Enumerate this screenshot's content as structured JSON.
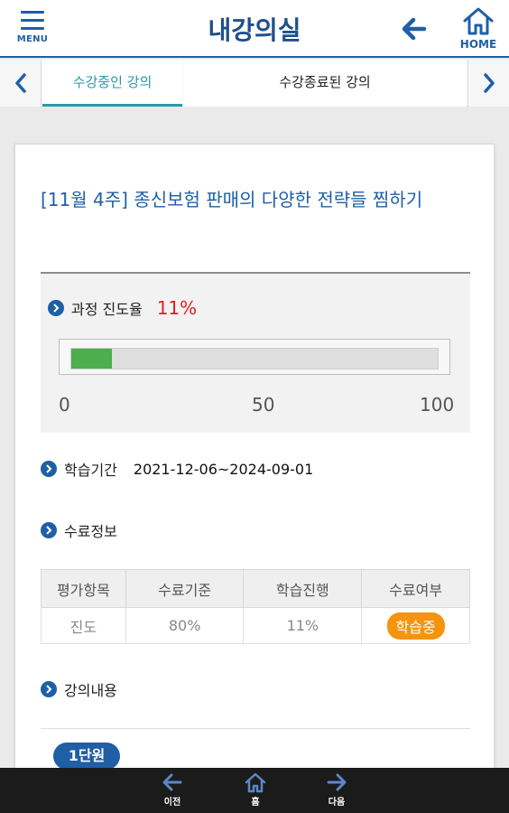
{
  "header": {
    "menu_label": "MENU",
    "title": "내강의실",
    "back_icon": "arrow-left-icon",
    "home_label": "HOME"
  },
  "tabs": {
    "active": "수강중인 강의",
    "inactive": "수강종료된 강의"
  },
  "course": {
    "title": "[11월 4주] 종신보험 판매의 다양한 전략들  찜하기",
    "progress": {
      "label": "과정 진도율",
      "percent_text": "11%",
      "value": 0.11,
      "scale": [
        "0",
        "50",
        "100"
      ]
    },
    "period": {
      "label": "학습기간",
      "value": "2021-12-06~2024-09-01"
    },
    "completion": {
      "label": "수료정보",
      "headers": [
        "평가항목",
        "수료기준",
        "학습진행",
        "수료여부"
      ],
      "row": [
        "진도",
        "80%",
        "11%"
      ],
      "status": "학습중"
    },
    "contents": {
      "label": "강의내용",
      "unit": "1단원"
    }
  },
  "colors": {
    "primary": "#1f5fa6",
    "accent_tab": "#2a9aa8",
    "progress": "#4cae4c",
    "percent": "#e02020",
    "status": "#f5940f"
  },
  "bottom_nav": {
    "prev": "이전",
    "home": "홈",
    "next": "다음"
  }
}
